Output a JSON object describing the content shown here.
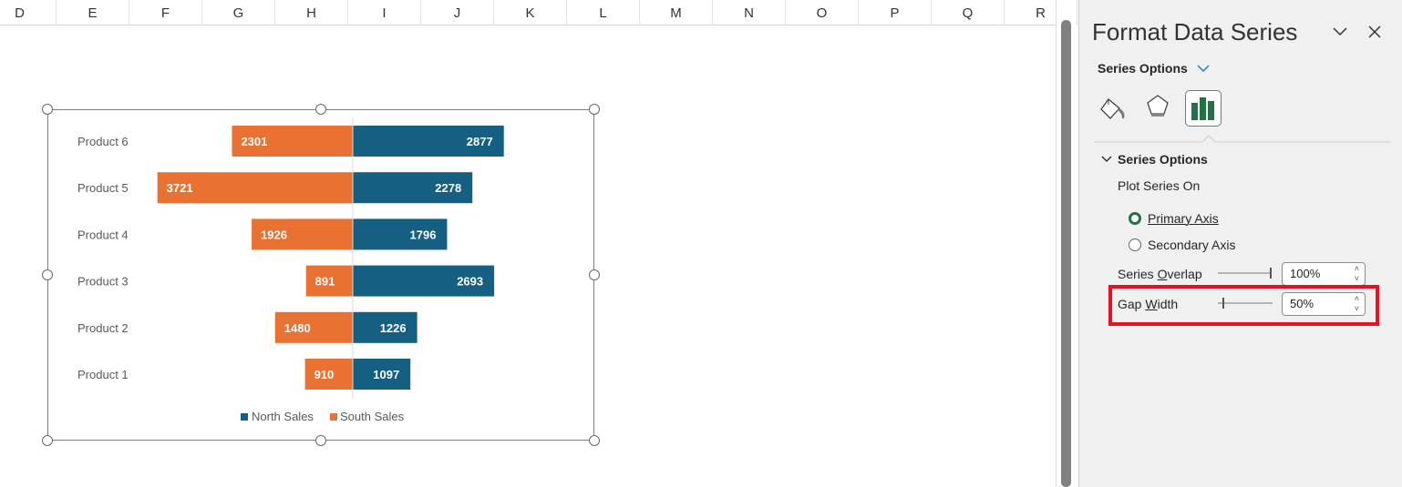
{
  "columns": [
    "D",
    "E",
    "F",
    "G",
    "H",
    "I",
    "J",
    "K",
    "L",
    "M",
    "N",
    "O",
    "P",
    "Q",
    "R"
  ],
  "chart_data": {
    "type": "bar",
    "orientation": "horizontal",
    "style": "butterfly",
    "categories": [
      "Product 6",
      "Product 5",
      "Product 4",
      "Product 3",
      "Product 2",
      "Product 1"
    ],
    "series": [
      {
        "name": "North Sales",
        "color": "#156082",
        "values": [
          2877,
          2278,
          1796,
          2693,
          1226,
          1097
        ]
      },
      {
        "name": "South Sales",
        "color": "#E97132",
        "values": [
          2301,
          3721,
          1926,
          891,
          1480,
          910
        ]
      }
    ],
    "data_labels": true,
    "legend": "bottom",
    "grid": false
  },
  "panel": {
    "title": "Format Data Series",
    "dropdown_label": "Series Options",
    "icons": [
      "fill-line-icon",
      "effects-icon",
      "series-options-icon"
    ],
    "section_title": "Series Options",
    "plot_on_label": "Plot Series On",
    "primary_label": "Primary Axis",
    "secondary_label": "Secondary Axis",
    "primary_selected": true,
    "overlap_label_pre": "Series ",
    "overlap_label_ul": "O",
    "overlap_label_post": "verlap",
    "overlap_value": "100%",
    "overlap_level": 100,
    "gap_label_pre": "Gap ",
    "gap_label_ul": "W",
    "gap_label_post": "idth",
    "gap_value": "50%",
    "gap_level": 10,
    "accent": "#217346",
    "highlight_color": "#E81123"
  }
}
